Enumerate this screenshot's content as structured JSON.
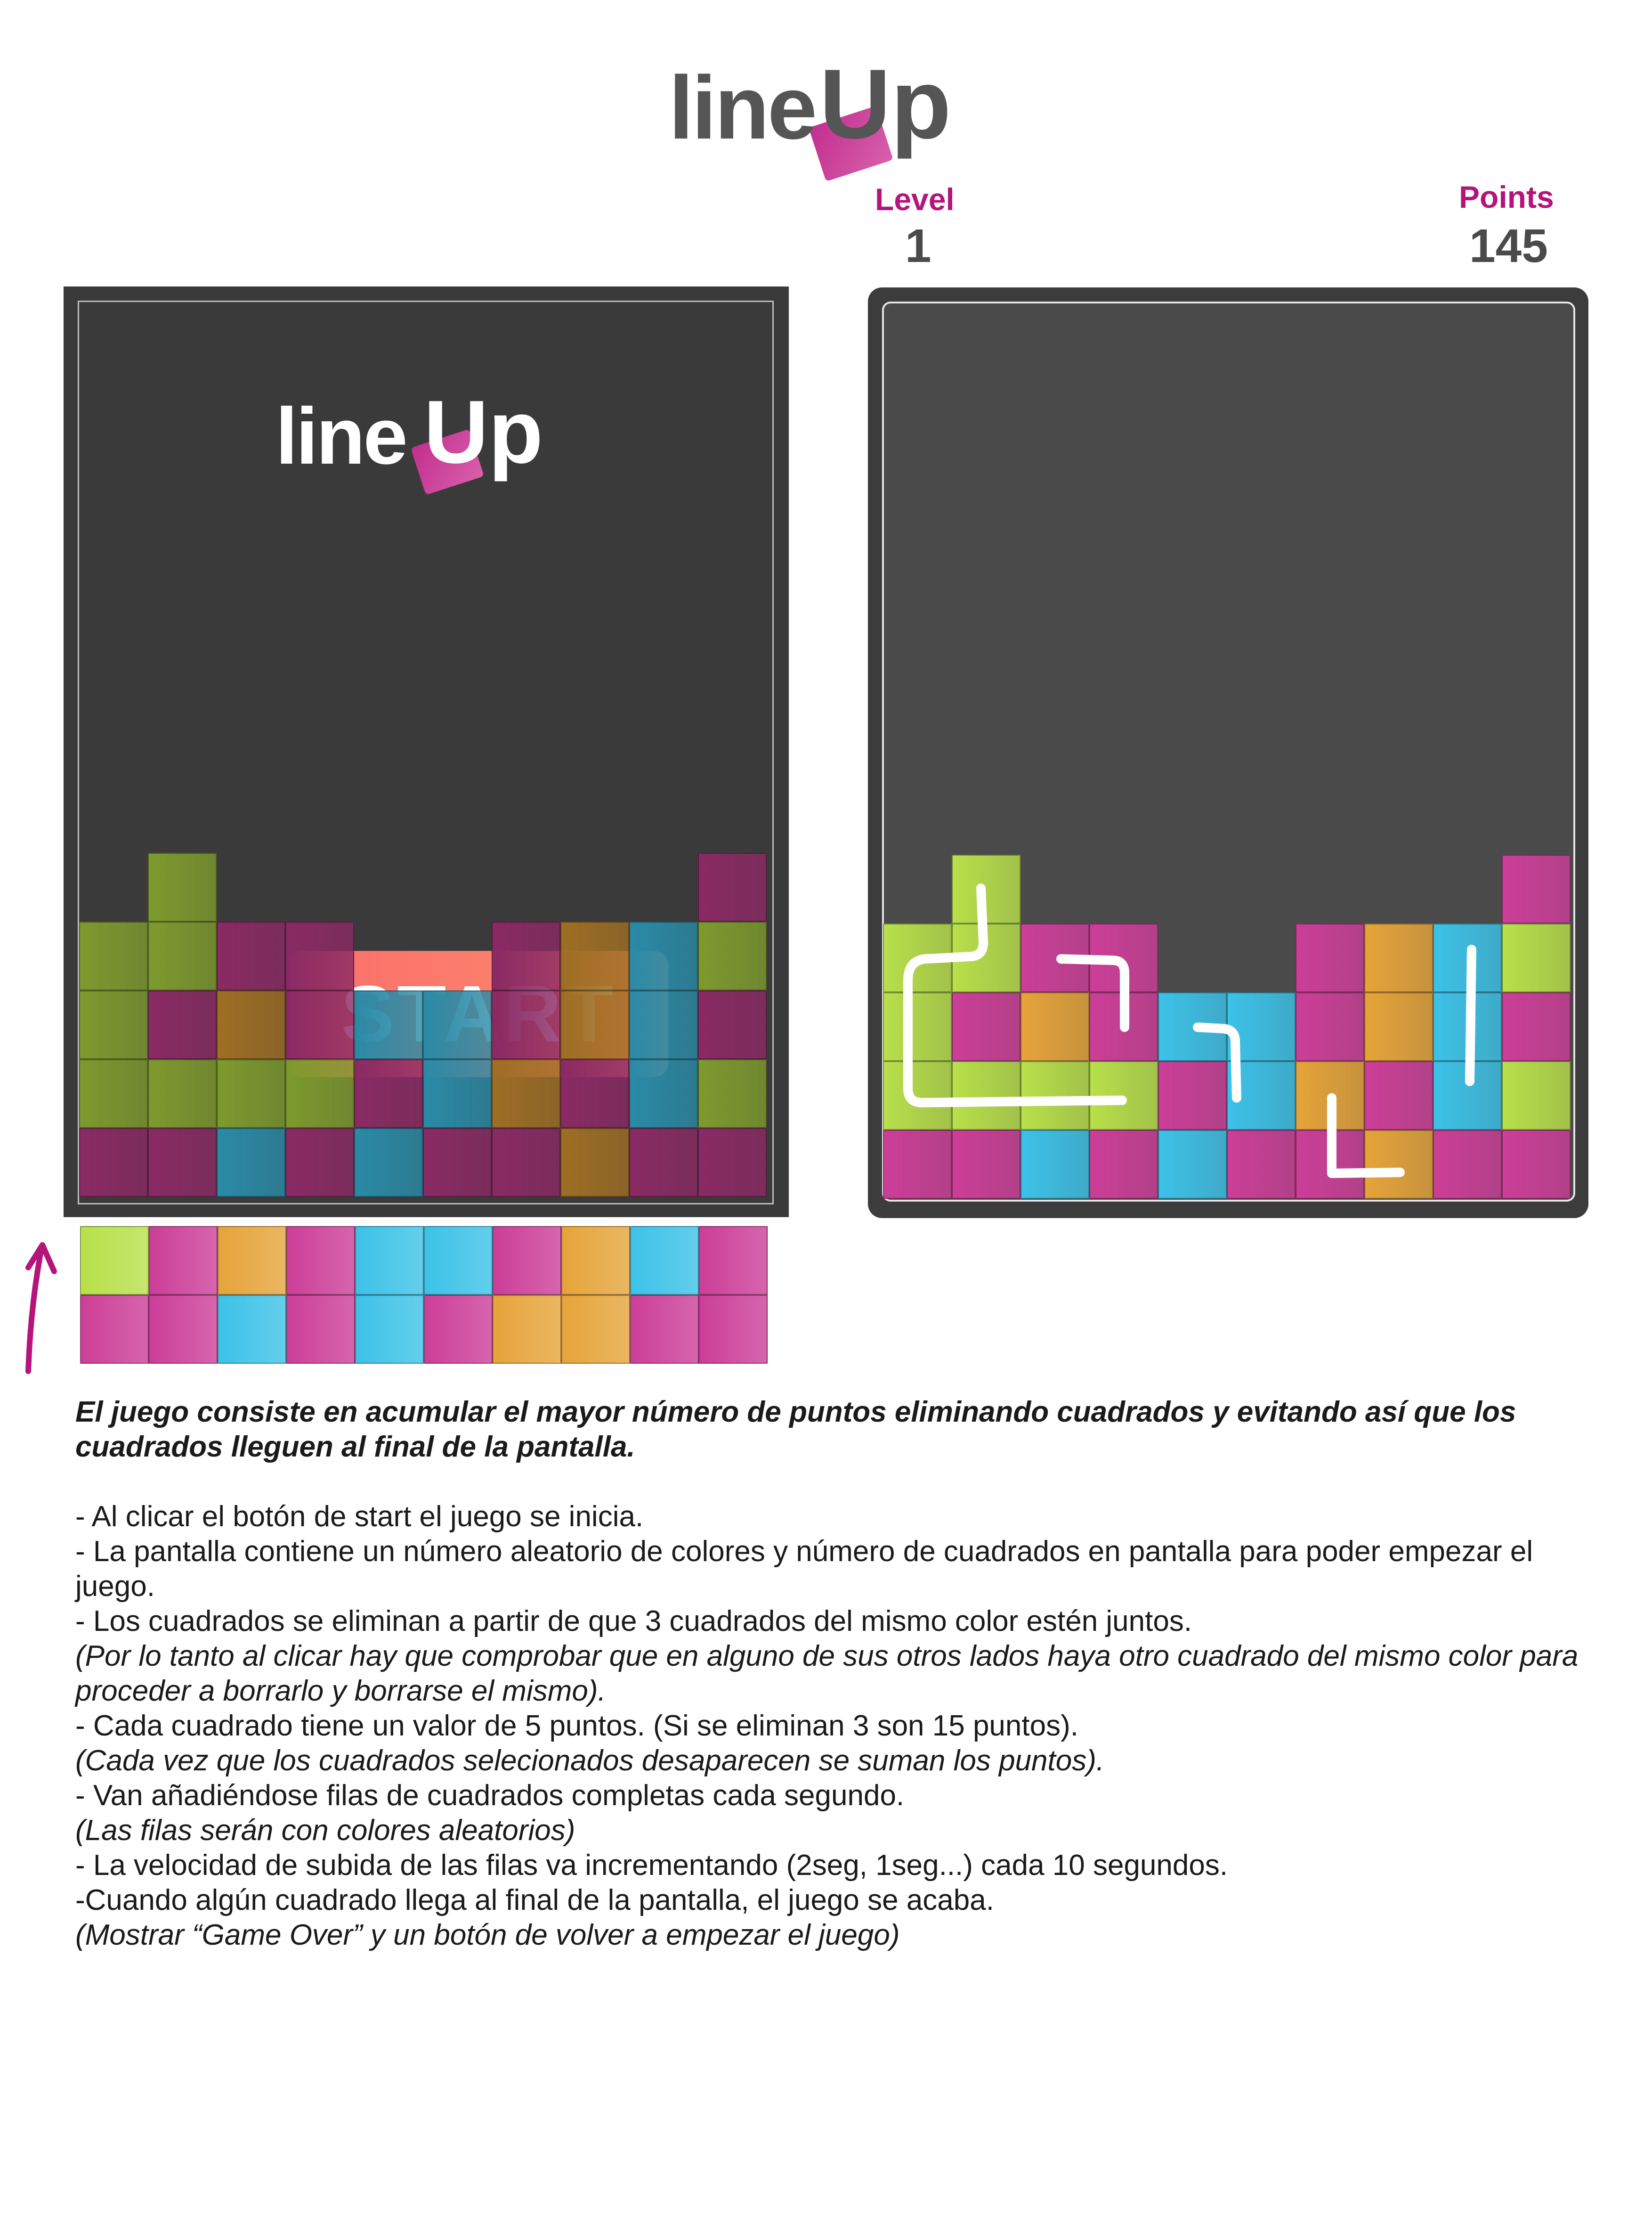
{
  "logo": {
    "text": "line",
    "up": "Up"
  },
  "hud": {
    "level_label": "Level",
    "level_value": "1",
    "points_label": "Points",
    "points_value": "145"
  },
  "start_button": {
    "label": "START"
  },
  "colors": {
    "green": "#b8e04a",
    "pink": "#cc3e98",
    "orange": "#e6a43a",
    "cyan": "#3cc2e8",
    "dim_green": "#7d9a2e",
    "dim_pink": "#8a2a64",
    "dim_orange": "#9e6e24",
    "dim_cyan": "#2a8aa6",
    "accent": "#b5147a"
  },
  "left_grid": [
    "..........",
    ".g.......p",
    "ggpp..pocg",
    "gpopccpocp",
    "ggggpcopcg",
    "ppcpcppopp"
  ],
  "right_grid": [
    "..........",
    ".g.......p",
    "ggpp..pocg",
    "gpopccpocp",
    "ggggpcopcg",
    "ppcpcppopp"
  ],
  "incoming_rows": [
    "gpopccpocp",
    "ppcpcpoopp"
  ],
  "description": {
    "intro": "El juego consiste en acumular el mayor número de puntos eliminando cuadrados y evitando así que los cuadrados lleguen al final de la pantalla.",
    "lines": [
      {
        "text": "- Al clicar el botón de start el juego se inicia.",
        "italic": false
      },
      {
        "text": "- La pantalla contiene un número aleatorio de colores y número de cuadrados en pantalla para poder empezar el juego.",
        "italic": false
      },
      {
        "text": "- Los cuadrados se eliminan a partir de que 3 cuadrados del mismo color estén juntos.",
        "italic": false
      },
      {
        "text": "(Por lo tanto al clicar hay que comprobar que en alguno de sus otros lados haya otro cuadrado del mismo color para proceder a borrarlo y borrarse el mismo).",
        "italic": true
      },
      {
        "text": "- Cada cuadrado tiene un valor de 5 puntos. (Si se eliminan 3 son 15 puntos).",
        "italic": false
      },
      {
        "text": "(Cada vez que los cuadrados selecionados desaparecen se suman los puntos).",
        "italic": true
      },
      {
        "text": "- Van añadiéndose filas de cuadrados completas cada segundo.",
        "italic": false
      },
      {
        "text": "(Las filas serán con colores aleatorios)",
        "italic": true
      },
      {
        "text": "- La velocidad de subida de las filas va incrementando (2seg, 1seg...) cada 10 segundos.",
        "italic": false
      },
      {
        "text": "-Cuando algún cuadrado llega al final de la pantalla, el juego se acaba.",
        "italic": false
      },
      {
        "text": "(Mostrar “Game Over” y un botón de volver a empezar el juego)",
        "italic": true
      }
    ]
  }
}
